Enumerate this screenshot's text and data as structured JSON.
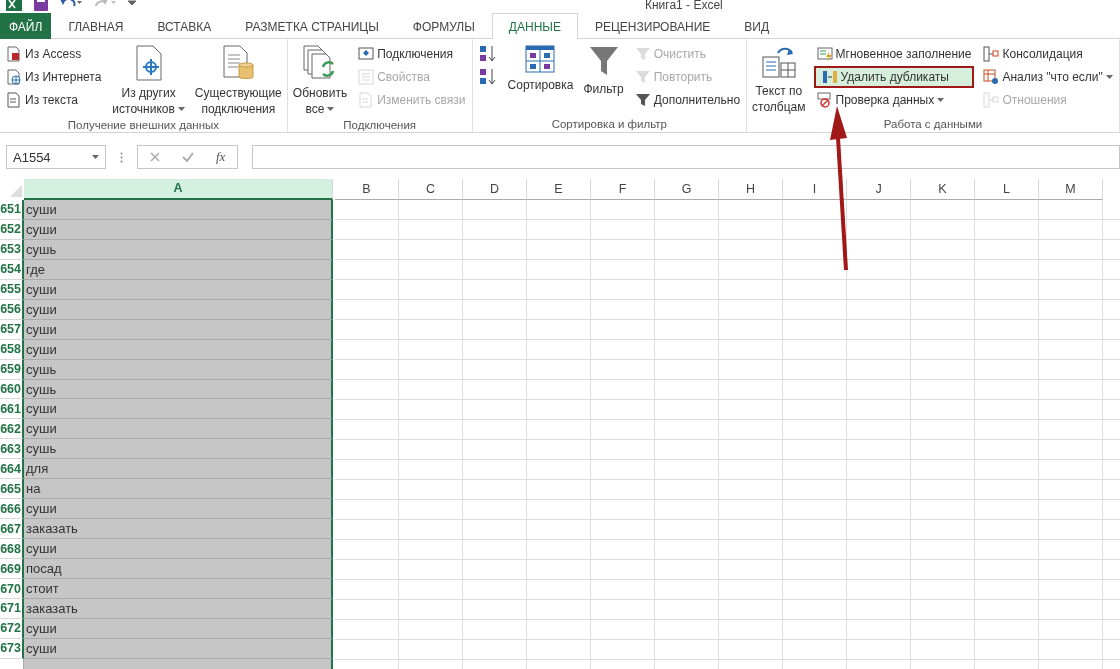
{
  "window": {
    "title": "Книга1 - Excel"
  },
  "tabs": [
    {
      "label": "ФАЙЛ",
      "kind": "file",
      "selected": false
    },
    {
      "label": "ГЛАВНАЯ",
      "kind": "tab",
      "selected": false
    },
    {
      "label": "ВСТАВКА",
      "kind": "tab",
      "selected": false
    },
    {
      "label": "РАЗМЕТКА СТРАНИЦЫ",
      "kind": "tab",
      "selected": false
    },
    {
      "label": "ФОРМУЛЫ",
      "kind": "tab",
      "selected": false
    },
    {
      "label": "ДАННЫЕ",
      "kind": "tab",
      "selected": true
    },
    {
      "label": "РЕЦЕНЗИРОВАНИЕ",
      "kind": "tab",
      "selected": false
    },
    {
      "label": "ВИД",
      "kind": "tab",
      "selected": false
    }
  ],
  "ribbon_groups": [
    {
      "label": "Получение внешних данных",
      "columns": [
        {
          "kind": "stack",
          "items": [
            {
              "label": "Из Access",
              "disabled": false,
              "highlighted": false,
              "dropdown": false
            },
            {
              "label": "Из Интернета",
              "disabled": false,
              "highlighted": false,
              "dropdown": false
            },
            {
              "label": "Из текста",
              "disabled": false,
              "highlighted": false,
              "dropdown": false
            }
          ]
        },
        {
          "kind": "large",
          "lines": [
            "Из других",
            "источников"
          ],
          "dropdown": true
        },
        {
          "kind": "large",
          "lines": [
            "Существующие",
            "подключения"
          ],
          "dropdown": false
        }
      ]
    },
    {
      "label": "Подключения",
      "columns": [
        {
          "kind": "large",
          "lines": [
            "Обновить",
            "все"
          ],
          "dropdown": true
        },
        {
          "kind": "stack",
          "items": [
            {
              "label": "Подключения",
              "disabled": false,
              "highlighted": false,
              "dropdown": false
            },
            {
              "label": "Свойства",
              "disabled": true,
              "highlighted": false,
              "dropdown": false
            },
            {
              "label": "Изменить связи",
              "disabled": true,
              "highlighted": false,
              "dropdown": false
            }
          ]
        }
      ]
    },
    {
      "label": "Сортировка и фильтр",
      "columns": [
        {
          "kind": "stack",
          "items": [
            {
              "disabled": false,
              "highlighted": false,
              "dropdown": false
            },
            {
              "disabled": false,
              "highlighted": false,
              "dropdown": false
            }
          ]
        },
        {
          "kind": "large",
          "lines": [
            "Сортировка"
          ],
          "dropdown": false
        },
        {
          "kind": "large",
          "lines": [
            "Фильтр"
          ],
          "dropdown": false
        },
        {
          "kind": "stack",
          "items": [
            {
              "label": "Очистить",
              "disabled": true,
              "highlighted": false,
              "dropdown": false
            },
            {
              "label": "Повторить",
              "disabled": true,
              "highlighted": false,
              "dropdown": false
            },
            {
              "label": "Дополнительно",
              "disabled": false,
              "highlighted": false,
              "dropdown": false
            }
          ]
        }
      ]
    },
    {
      "label": "Работа с данными",
      "columns": [
        {
          "kind": "large",
          "lines": [
            "Текст по",
            "столбцам"
          ],
          "dropdown": false
        },
        {
          "kind": "stack",
          "items": [
            {
              "label": "Мгновенное заполнение",
              "disabled": false,
              "highlighted": false,
              "dropdown": false
            },
            {
              "label": "Удалить дубликаты",
              "disabled": false,
              "highlighted": true,
              "dropdown": false
            },
            {
              "label": "Проверка данных",
              "disabled": false,
              "highlighted": false,
              "dropdown": true
            }
          ]
        },
        {
          "kind": "stack",
          "items": [
            {
              "label": "Консолидация",
              "disabled": false,
              "highlighted": false,
              "dropdown": false
            },
            {
              "label": "Анализ \"что если\"",
              "disabled": false,
              "highlighted": false,
              "dropdown": true
            },
            {
              "label": "Отношения",
              "disabled": true,
              "highlighted": false,
              "dropdown": false
            }
          ]
        }
      ]
    }
  ],
  "formula_bar": {
    "name_box": "A1554",
    "fx": "fx"
  },
  "columns": [
    {
      "label": "A",
      "selected": true
    },
    {
      "label": "B",
      "selected": false
    },
    {
      "label": "C",
      "selected": false
    },
    {
      "label": "D",
      "selected": false
    },
    {
      "label": "E",
      "selected": false
    },
    {
      "label": "F",
      "selected": false
    },
    {
      "label": "G",
      "selected": false
    },
    {
      "label": "H",
      "selected": false
    },
    {
      "label": "I",
      "selected": false
    },
    {
      "label": "J",
      "selected": false
    },
    {
      "label": "K",
      "selected": false
    },
    {
      "label": "L",
      "selected": false
    },
    {
      "label": "M",
      "selected": false
    }
  ],
  "rows": [
    {
      "number": "651",
      "a": "суши",
      "selected": true
    },
    {
      "number": "652",
      "a": "суши",
      "selected": true
    },
    {
      "number": "653",
      "a": "сушь",
      "selected": true
    },
    {
      "number": "654",
      "a": "где",
      "selected": true
    },
    {
      "number": "655",
      "a": "суши",
      "selected": true
    },
    {
      "number": "656",
      "a": "суши",
      "selected": true
    },
    {
      "number": "657",
      "a": "суши",
      "selected": true
    },
    {
      "number": "658",
      "a": "суши",
      "selected": true
    },
    {
      "number": "659",
      "a": "сушь",
      "selected": true
    },
    {
      "number": "660",
      "a": "сушь",
      "selected": true
    },
    {
      "number": "661",
      "a": "суши",
      "selected": true
    },
    {
      "number": "662",
      "a": "суши",
      "selected": true
    },
    {
      "number": "663",
      "a": "сушь",
      "selected": true
    },
    {
      "number": "664",
      "a": "для",
      "selected": true
    },
    {
      "number": "665",
      "a": "на",
      "selected": true
    },
    {
      "number": "666",
      "a": "суши",
      "selected": true
    },
    {
      "number": "667",
      "a": "заказать",
      "selected": true
    },
    {
      "number": "668",
      "a": "суши",
      "selected": true
    },
    {
      "number": "669",
      "a": "посад",
      "selected": true
    },
    {
      "number": "670",
      "a": "стоит",
      "selected": true
    },
    {
      "number": "671",
      "a": "заказать",
      "selected": true
    },
    {
      "number": "672",
      "a": "суши",
      "selected": true
    },
    {
      "number": "673",
      "a": "суши",
      "selected": true
    }
  ]
}
